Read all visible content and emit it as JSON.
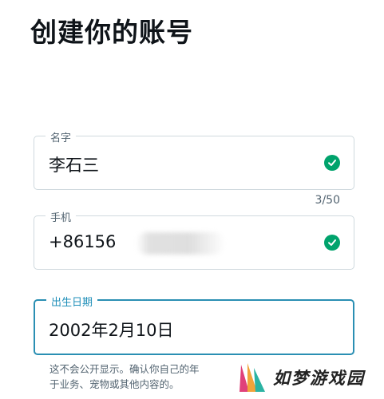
{
  "page": {
    "title": "创建你的账号"
  },
  "fields": {
    "name": {
      "label": "名字",
      "value": "李石三",
      "counter": "3/50"
    },
    "phone": {
      "label": "手机",
      "value": "+86156"
    },
    "birthday": {
      "label": "出生日期",
      "value": "2002年2月10日"
    }
  },
  "note": {
    "line1": "这不会公开显示。确认你自己的年",
    "line2": "于业务、宠物或其他内容的。"
  },
  "watermark": {
    "text": "如梦游戏园"
  },
  "colors": {
    "focus": "#2a8fb3",
    "valid": "#00a36c",
    "muted": "#536471"
  },
  "icons": {
    "valid": "check-circle-icon"
  }
}
